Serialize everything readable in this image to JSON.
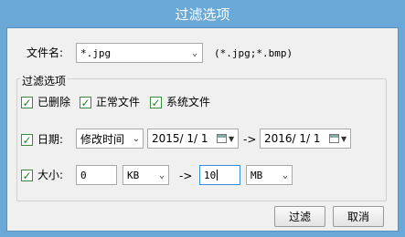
{
  "title": "过滤选项",
  "file_name": {
    "label": "文件名:",
    "value": "*.jpg",
    "hint": "(*.jpg;*.bmp)"
  },
  "group": {
    "legend": "过滤选项",
    "deleted_label": "已删除",
    "normal_label": "正常文件",
    "system_label": "系统文件",
    "check_mark": "✓"
  },
  "date_row": {
    "label": "日期:",
    "field": "修改时间",
    "from": "2015/ 1/ 1",
    "arrow": "->",
    "to": "2016/ 1/ 1"
  },
  "size_row": {
    "label": "大小:",
    "min_value": "0",
    "min_unit": "KB",
    "arrow": "->",
    "max_value": "10",
    "max_unit": "MB"
  },
  "buttons": {
    "filter": "过滤",
    "cancel": "取消"
  },
  "colors": {
    "titlebar": "#6aa8d8",
    "check": "#1f8a1f"
  }
}
